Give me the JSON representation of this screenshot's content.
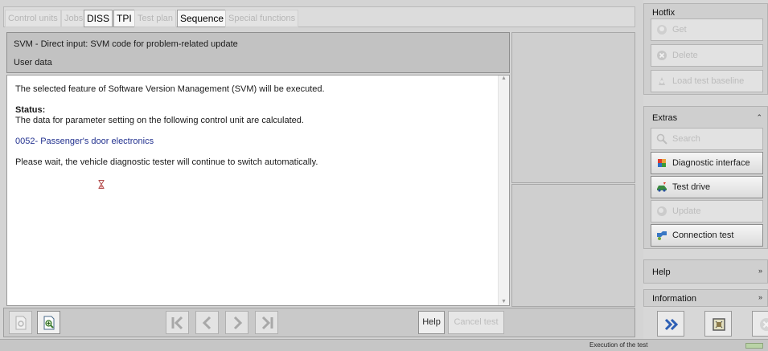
{
  "tabs": [
    {
      "label": "Control units",
      "active": false
    },
    {
      "label": "Jobs",
      "active": false
    },
    {
      "label": "DISS",
      "active": true
    },
    {
      "label": "TPI",
      "active": true
    },
    {
      "label": "Test plan",
      "active": false
    },
    {
      "label": "Sequence",
      "active": true
    },
    {
      "label": "Special functions",
      "active": false
    }
  ],
  "header": {
    "title": "SVM - Direct input: SVM code for problem-related update",
    "subtitle": "User data"
  },
  "content": {
    "line1": "The selected feature of Software Version Management (SVM) will be executed.",
    "status_label": "Status:",
    "status_text": "The data for parameter setting on the following control unit are calculated.",
    "control_unit": "0052- Passenger's door electronics",
    "wait_text": "Please wait, the vehicle diagnostic tester will continue to switch automatically."
  },
  "toolbar": {
    "help_label": "Help",
    "cancel_label": "Cancel test"
  },
  "hotfix": {
    "title": "Hotfix",
    "get_label": "Get",
    "delete_label": "Delete",
    "load_baseline_label": "Load test baseline"
  },
  "extras": {
    "title": "Extras",
    "search_label": "Search",
    "diag_interface_label": "Diagnostic interface",
    "test_drive_label": "Test drive",
    "update_label": "Update",
    "connection_test_label": "Connection test"
  },
  "help_group": {
    "title": "Help"
  },
  "info_group": {
    "title": "Information"
  },
  "status_bar": {
    "text": "Execution of the test"
  },
  "colors": {
    "accent_blue": "#22318f",
    "forward_button": "#2d5fb5"
  }
}
